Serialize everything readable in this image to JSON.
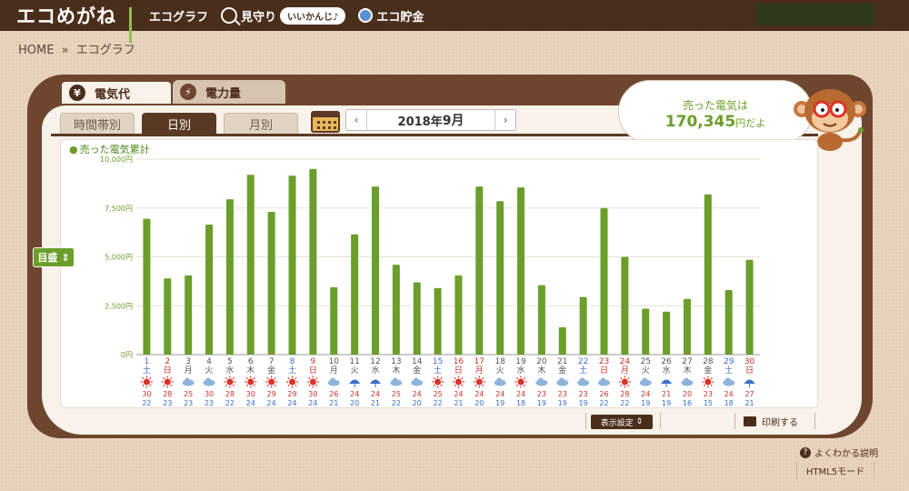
{
  "app": {
    "logo": "エコめがね",
    "nav": [
      {
        "label": "エコグラフ",
        "icon": "bar-chart-icon"
      },
      {
        "label": "見守り",
        "icon": "magnifier-icon",
        "badge": "いいかんじ♪"
      },
      {
        "label": "エコ貯金",
        "icon": "coin-icon"
      }
    ]
  },
  "breadcrumb": {
    "home": "HOME",
    "sep": "»",
    "current": "エコグラフ"
  },
  "tabs": {
    "main": [
      {
        "label": "電気代",
        "icon": "yen-icon",
        "active": true
      },
      {
        "label": "電力量",
        "icon": "lightning-icon",
        "active": false
      }
    ],
    "sub": [
      {
        "label": "時間帯別",
        "active": false
      },
      {
        "label": "日別",
        "active": true
      },
      {
        "label": "月別",
        "active": false
      }
    ]
  },
  "date_nav": {
    "prev": "‹",
    "next": "›",
    "year": "2018年",
    "month": "9月"
  },
  "sold_bubble": {
    "line1": "売った電気は",
    "amount": "170,345",
    "suffix": "円だよ"
  },
  "unit_selector": {
    "label": "目盛",
    "arrow": "⇕"
  },
  "footer": {
    "display_settings": "表示設定",
    "print": "印刷する",
    "help": "よくわかる説明",
    "html5": "HTML5モード"
  },
  "chart_data": {
    "type": "bar",
    "legend": "売った電気累計",
    "y_ticks": [
      "0円",
      "2,500円",
      "5,000円",
      "7,500円",
      "10,000円"
    ],
    "ylim": [
      0,
      10000
    ],
    "color": "#6b9e2a",
    "days": [
      "1",
      "2",
      "3",
      "4",
      "5",
      "6",
      "7",
      "8",
      "9",
      "10",
      "11",
      "12",
      "13",
      "14",
      "15",
      "16",
      "17",
      "18",
      "19",
      "20",
      "21",
      "22",
      "23",
      "24",
      "25",
      "26",
      "27",
      "28",
      "29",
      "30"
    ],
    "weekdays": [
      "土",
      "日",
      "月",
      "火",
      "水",
      "木",
      "金",
      "土",
      "日",
      "月",
      "火",
      "水",
      "木",
      "金",
      "土",
      "日",
      "月",
      "火",
      "水",
      "木",
      "金",
      "土",
      "日",
      "月",
      "火",
      "水",
      "木",
      "金",
      "土",
      "日"
    ],
    "day_colors": [
      "sat",
      "sun",
      "",
      "",
      "",
      "",
      "",
      "sat",
      "sun",
      "",
      "",
      "",
      "",
      "",
      "sat",
      "sun",
      "hol",
      "",
      "",
      "",
      "",
      "sat",
      "sun",
      "hol",
      "",
      "",
      "",
      "",
      "sat",
      "sun"
    ],
    "values": [
      6950,
      3900,
      4050,
      6650,
      7950,
      9200,
      7300,
      9150,
      9500,
      3450,
      6150,
      8600,
      4600,
      3700,
      3400,
      4050,
      8600,
      7850,
      8550,
      3550,
      1400,
      2950,
      7500,
      5000,
      2350,
      2200,
      2850,
      8200,
      3300,
      4850
    ],
    "weather": [
      "sun",
      "sun",
      "cloud",
      "cloud",
      "sun",
      "sun",
      "sun",
      "sun",
      "sun",
      "cloud",
      "rain",
      "rain",
      "cloud",
      "cloud",
      "sun",
      "sun",
      "sun",
      "cloud",
      "sun",
      "cloud",
      "cloud",
      "cloud",
      "cloud",
      "sun",
      "cloud",
      "rain",
      "cloud",
      "sun",
      "cloud",
      "rain"
    ],
    "temp_high": [
      "30",
      "28",
      "25",
      "30",
      "28",
      "30",
      "29",
      "29",
      "30",
      "26",
      "24",
      "24",
      "25",
      "24",
      "25",
      "24",
      "24",
      "24",
      "24",
      "23",
      "23",
      "23",
      "26",
      "28",
      "24",
      "21",
      "20",
      "23",
      "24",
      "27"
    ],
    "temp_low": [
      "22",
      "23",
      "23",
      "23",
      "22",
      "24",
      "24",
      "24",
      "24",
      "21",
      "20",
      "21",
      "22",
      "20",
      "22",
      "21",
      "20",
      "19",
      "18",
      "19",
      "19",
      "19",
      "22",
      "22",
      "19",
      "19",
      "16",
      "15",
      "18",
      "21"
    ]
  }
}
